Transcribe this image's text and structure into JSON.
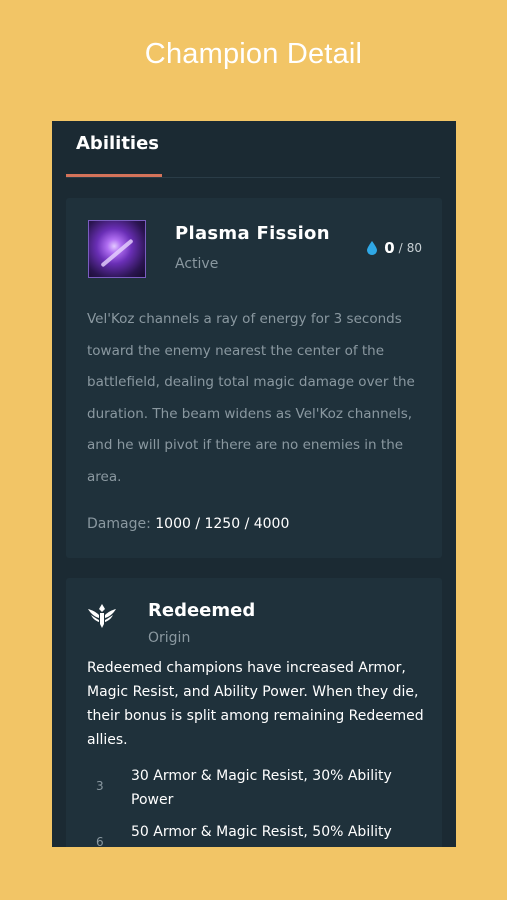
{
  "page": {
    "title": "Champion Detail"
  },
  "tabs": [
    {
      "label": "Abilities",
      "active": true
    }
  ],
  "ability": {
    "name": "Plasma Fission",
    "type": "Active",
    "mana_current": "0",
    "mana_separator": "/",
    "mana_max": "80",
    "description": "Vel'Koz channels a ray of energy for 3 seconds toward the enemy nearest the center of the battlefield, dealing total magic damage over the duration. The beam widens as Vel'Koz channels, and he will pivot if there are no enemies in the area.",
    "damage_label": "Damage:",
    "damage_values": "1000 / 1250 / 4000",
    "icon": "plasma-fission-ability-icon"
  },
  "trait": {
    "name": "Redeemed",
    "type": "Origin",
    "icon": "redeemed-emblem-icon",
    "description": "Redeemed champions have increased Armor, Magic Resist, and Ability Power. When they die, their bonus is split among remaining Redeemed allies.",
    "bonuses": [
      {
        "count": "3",
        "text": "30 Armor & Magic Resist, 30% Ability Power"
      },
      {
        "count": "6",
        "text": "50 Armor & Magic Resist, 50% Ability"
      }
    ]
  },
  "colors": {
    "background": "#f2c566",
    "panel": "#1b2a33",
    "card": "#1f313b",
    "tab_accent": "#d4735a",
    "mana": "#2fa8e6",
    "muted_text": "#8a98a0"
  }
}
